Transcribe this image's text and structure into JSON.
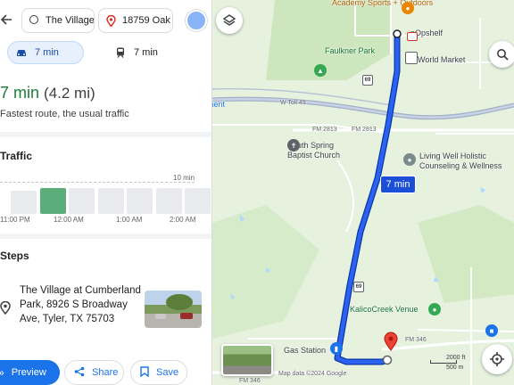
{
  "directions": {
    "origin": "The Village at Cumberland Park",
    "destination": "18759 Oak",
    "modes": [
      {
        "name": "driving",
        "label": "7 min",
        "selected": true
      },
      {
        "name": "transit",
        "label": "7 min",
        "selected": false
      }
    ]
  },
  "summary": {
    "duration": "7 min",
    "distance": "(4.2 mi)",
    "note": "Fastest route, the usual traffic"
  },
  "traffic": {
    "title": "Traffic",
    "max_label": "10 min",
    "bars": [
      {
        "level": 0.55,
        "active": false
      },
      {
        "level": 0.6,
        "active": true
      },
      {
        "level": 0.6,
        "active": false
      },
      {
        "level": 0.6,
        "active": false
      },
      {
        "level": 0.6,
        "active": false
      },
      {
        "level": 0.6,
        "active": false
      },
      {
        "level": 0.6,
        "active": false
      }
    ],
    "time_labels": [
      "11:00 PM",
      "12:00 AM",
      "1:00 AM",
      "2:00 AM"
    ]
  },
  "steps": {
    "title": "Steps",
    "start_text": "The Village at Cumberland Park, 8926 S Broadway Ave, Tyler, TX 75703"
  },
  "actions": {
    "preview": "Preview",
    "share": "Share",
    "save": "Save"
  },
  "map": {
    "route_time": "7 min",
    "labels": {
      "academy": "Academy Sports + Outdoors",
      "popshelf": "pOpshelf",
      "world_market": "World Market",
      "faulkner": "Faulkner Park",
      "toll49": "W Toll 49",
      "fm2813_a": "FM 2813",
      "fm2813_b": "FM 2813",
      "church": "South Spring Baptist Church",
      "living_well": "Living Well Holistic Counseling & Wellness",
      "kalico": "KalicoCreek Venue",
      "gas": "Gas Station",
      "fm346_a": "FM 346",
      "fm346_b": "FM 346",
      "attribution": "Map data ©2024 Google",
      "ment": "ment"
    },
    "shields": [
      "69",
      "69"
    ],
    "scale": [
      "2000 ft",
      "500 m"
    ],
    "colors": {
      "route": "#1a4fd6",
      "destination_pin": "#ea4335",
      "park": "#c7e3b5",
      "water": "#aadaff"
    }
  }
}
